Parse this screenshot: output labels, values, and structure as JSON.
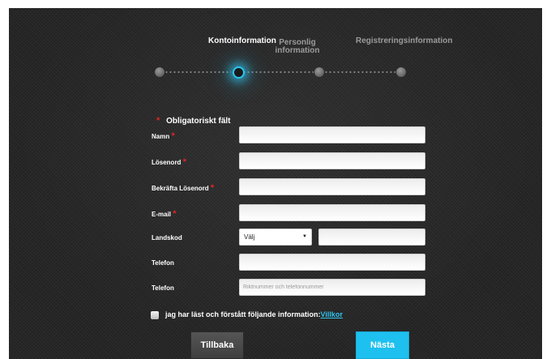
{
  "steps": {
    "step1": "Kontoinformation",
    "step2_line1": "Personlig",
    "step2_line2": "information",
    "step3": "Registreringsinformation"
  },
  "form": {
    "required_note": "Obligatoriskt fält",
    "required_marker": "*",
    "name_label": "Namn",
    "password_label": "Lösenord",
    "confirm_password_label": "Bekräfta Lösenord",
    "email_label": "E-mail",
    "country_code_label": "Landskod",
    "country_code_selected": "Välj",
    "phone_label": "Telefon",
    "phone2_label": "Telefon",
    "phone2_placeholder": "Riktnummer och telefonnummer",
    "agree_text": "jag har läst och förstått följande information:",
    "terms_link": "Villkor"
  },
  "buttons": {
    "back": "Tillbaka",
    "next": "Nästa"
  },
  "colors": {
    "accent": "#1ec0ef",
    "required": "#e32626",
    "background": "#252525"
  },
  "progress": {
    "current_step": 1,
    "total_steps": 4
  }
}
